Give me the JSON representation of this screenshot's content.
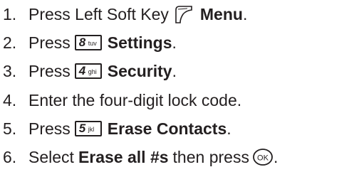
{
  "steps": [
    {
      "num": "1.",
      "pre": "Press Left Soft Key",
      "icon": "left-softkey-icon",
      "bold": "Menu",
      "post": "."
    },
    {
      "num": "2.",
      "pre": "Press",
      "key": {
        "digit": "8",
        "letters": "tuv"
      },
      "bold": "Settings",
      "post": "."
    },
    {
      "num": "3.",
      "pre": "Press",
      "key": {
        "digit": "4",
        "letters": "ghi"
      },
      "bold": "Security",
      "post": "."
    },
    {
      "num": "4.",
      "text": "Enter the four-digit lock code."
    },
    {
      "num": "5.",
      "pre": "Press",
      "key": {
        "digit": "5",
        "letters": "jkl"
      },
      "bold": "Erase Contacts",
      "post": "."
    },
    {
      "num": "6.",
      "pre": "Select",
      "bold": "Erase all #s",
      "mid": "then press",
      "icon": "ok-button-icon",
      "ok_label": "OK",
      "post": "."
    }
  ]
}
